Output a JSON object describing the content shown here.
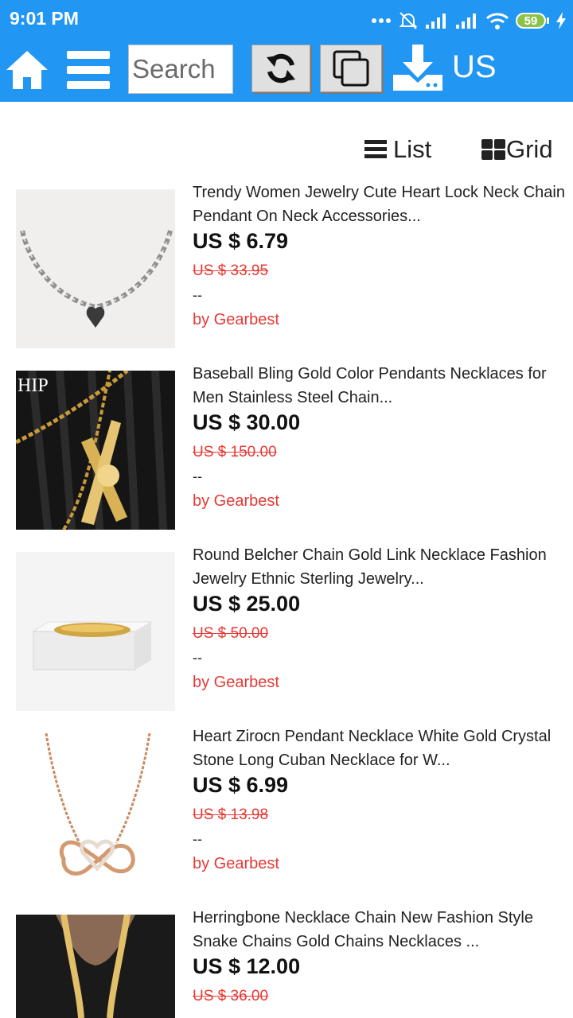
{
  "status_bar": {
    "time": "9:01 PM",
    "battery": "59"
  },
  "toolbar": {
    "search_placeholder": "Search",
    "region": "US"
  },
  "view_toggle": {
    "list_label": "List",
    "grid_label": "Grid"
  },
  "products": [
    {
      "title": "Trendy Women Jewelry Cute Heart Lock Neck Chain Pendant On Neck Accessories...",
      "price": "US $ 6.79",
      "original_price": "US $ 33.95",
      "extra": "--",
      "seller": "by Gearbest"
    },
    {
      "title": "Baseball Bling Gold Color Pendants Necklaces for Men Stainless Steel Chain...",
      "price": "US $ 30.00",
      "original_price": "US $ 150.00",
      "extra": "--",
      "seller": "by Gearbest",
      "image_text": "HIP"
    },
    {
      "title": "Round Belcher Chain Gold Link Necklace Fashion Jewelry Ethnic Sterling Jewelry...",
      "price": "US $ 25.00",
      "original_price": "US $ 50.00",
      "extra": "--",
      "seller": "by Gearbest"
    },
    {
      "title": "Heart Zirocn Pendant Necklace White Gold Crystal Stone Long Cuban Necklace for W...",
      "price": "US $ 6.99",
      "original_price": "US $ 13.98",
      "extra": "--",
      "seller": "by Gearbest"
    },
    {
      "title": "Herringbone Necklace Chain New Fashion Style Snake Chains Gold Chains Necklaces ...",
      "price": "US $ 12.00",
      "original_price": "US $ 36.00"
    }
  ],
  "colors": {
    "primary": "#2196f3",
    "sale_red": "#e53935",
    "battery_green": "#8bc34a"
  }
}
